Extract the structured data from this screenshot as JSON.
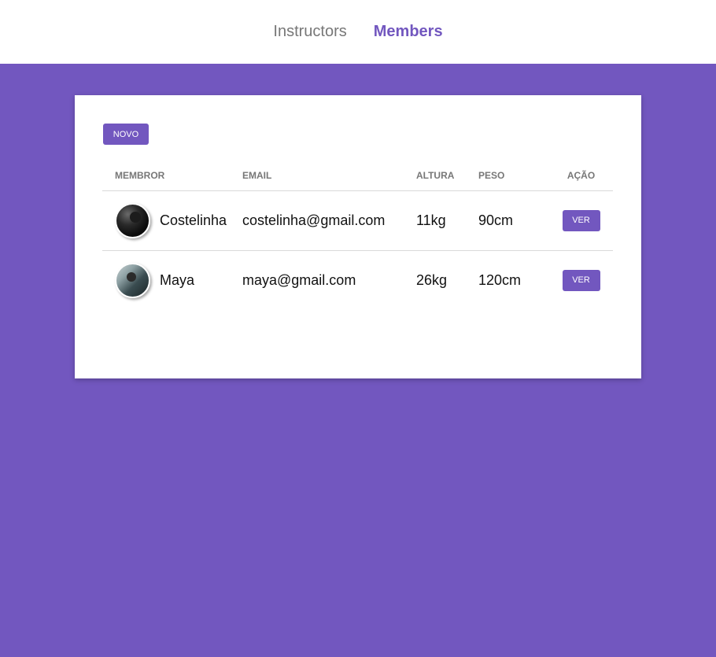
{
  "nav": {
    "items": [
      {
        "label": "Instructors",
        "active": false
      },
      {
        "label": "Members",
        "active": true
      }
    ]
  },
  "colors": {
    "accent": "#7257bf",
    "background": "#7257bf",
    "card": "#ffffff",
    "muted_text": "#777777"
  },
  "toolbar": {
    "new_label": "NOVO"
  },
  "table": {
    "headers": {
      "member": "MEMBROR",
      "email": "EMAIL",
      "height": "ALTURA",
      "weight": "PESO",
      "action": "AÇÃO"
    },
    "rows": [
      {
        "name": "Costelinha",
        "email": "costelinha@gmail.com",
        "altura": "11kg",
        "peso": "90cm",
        "action_label": "VER",
        "avatar_icon": "member-photo-avatar"
      },
      {
        "name": "Maya",
        "email": "maya@gmail.com",
        "altura": "26kg",
        "peso": "120cm",
        "action_label": "VER",
        "avatar_icon": "member-photo-avatar"
      }
    ]
  }
}
